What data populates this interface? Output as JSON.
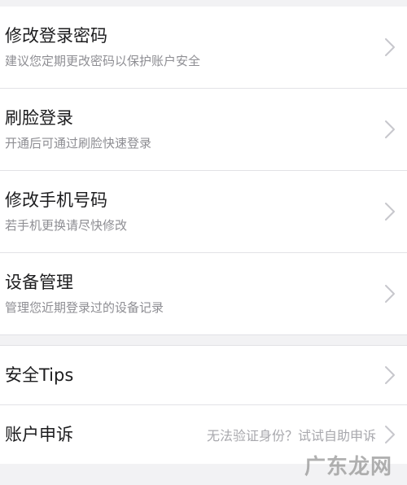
{
  "security_items": [
    {
      "title": "修改登录密码",
      "subtitle": "建议您定期更改密码以保护账户安全"
    },
    {
      "title": "刷脸登录",
      "subtitle": "开通后可通过刷脸快速登录"
    },
    {
      "title": "修改手机号码",
      "subtitle": "若手机更换请尽快修改"
    },
    {
      "title": "设备管理",
      "subtitle": "管理您近期登录过的设备记录"
    }
  ],
  "help_items": [
    {
      "title": "安全Tips",
      "hint": ""
    },
    {
      "title": "账户申诉",
      "hint": "无法验证身份？试试自助申诉"
    }
  ],
  "watermark": "广东龙网",
  "colors": {
    "background": "#f2f2f4",
    "row_background": "#ffffff",
    "title_text": "#1c1c1e",
    "subtitle_text": "#8e8e93",
    "chevron": "#c7c7cc"
  },
  "icons": {
    "chevron": "chevron-right-icon"
  }
}
